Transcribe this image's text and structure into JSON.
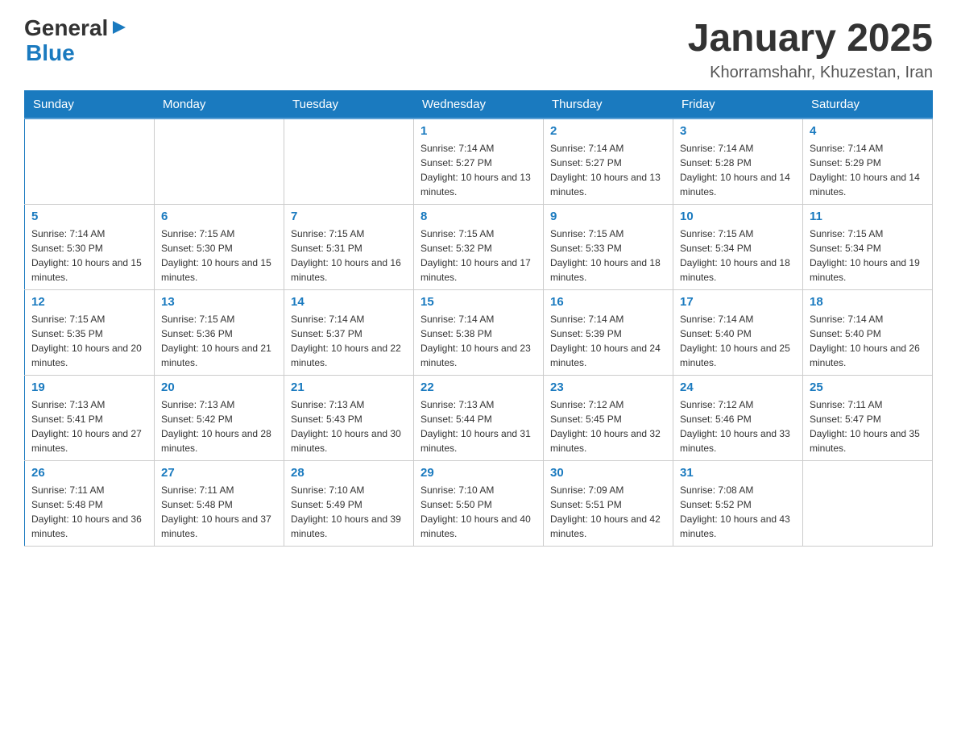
{
  "header": {
    "logo": {
      "text_general": "General",
      "arrow": "▶",
      "text_blue": "Blue"
    },
    "title": "January 2025",
    "location": "Khorramshahr, Khuzestan, Iran"
  },
  "calendar": {
    "days_of_week": [
      "Sunday",
      "Monday",
      "Tuesday",
      "Wednesday",
      "Thursday",
      "Friday",
      "Saturday"
    ],
    "weeks": [
      [
        {
          "day": "",
          "info": ""
        },
        {
          "day": "",
          "info": ""
        },
        {
          "day": "",
          "info": ""
        },
        {
          "day": "1",
          "info": "Sunrise: 7:14 AM\nSunset: 5:27 PM\nDaylight: 10 hours and 13 minutes."
        },
        {
          "day": "2",
          "info": "Sunrise: 7:14 AM\nSunset: 5:27 PM\nDaylight: 10 hours and 13 minutes."
        },
        {
          "day": "3",
          "info": "Sunrise: 7:14 AM\nSunset: 5:28 PM\nDaylight: 10 hours and 14 minutes."
        },
        {
          "day": "4",
          "info": "Sunrise: 7:14 AM\nSunset: 5:29 PM\nDaylight: 10 hours and 14 minutes."
        }
      ],
      [
        {
          "day": "5",
          "info": "Sunrise: 7:14 AM\nSunset: 5:30 PM\nDaylight: 10 hours and 15 minutes."
        },
        {
          "day": "6",
          "info": "Sunrise: 7:15 AM\nSunset: 5:30 PM\nDaylight: 10 hours and 15 minutes."
        },
        {
          "day": "7",
          "info": "Sunrise: 7:15 AM\nSunset: 5:31 PM\nDaylight: 10 hours and 16 minutes."
        },
        {
          "day": "8",
          "info": "Sunrise: 7:15 AM\nSunset: 5:32 PM\nDaylight: 10 hours and 17 minutes."
        },
        {
          "day": "9",
          "info": "Sunrise: 7:15 AM\nSunset: 5:33 PM\nDaylight: 10 hours and 18 minutes."
        },
        {
          "day": "10",
          "info": "Sunrise: 7:15 AM\nSunset: 5:34 PM\nDaylight: 10 hours and 18 minutes."
        },
        {
          "day": "11",
          "info": "Sunrise: 7:15 AM\nSunset: 5:34 PM\nDaylight: 10 hours and 19 minutes."
        }
      ],
      [
        {
          "day": "12",
          "info": "Sunrise: 7:15 AM\nSunset: 5:35 PM\nDaylight: 10 hours and 20 minutes."
        },
        {
          "day": "13",
          "info": "Sunrise: 7:15 AM\nSunset: 5:36 PM\nDaylight: 10 hours and 21 minutes."
        },
        {
          "day": "14",
          "info": "Sunrise: 7:14 AM\nSunset: 5:37 PM\nDaylight: 10 hours and 22 minutes."
        },
        {
          "day": "15",
          "info": "Sunrise: 7:14 AM\nSunset: 5:38 PM\nDaylight: 10 hours and 23 minutes."
        },
        {
          "day": "16",
          "info": "Sunrise: 7:14 AM\nSunset: 5:39 PM\nDaylight: 10 hours and 24 minutes."
        },
        {
          "day": "17",
          "info": "Sunrise: 7:14 AM\nSunset: 5:40 PM\nDaylight: 10 hours and 25 minutes."
        },
        {
          "day": "18",
          "info": "Sunrise: 7:14 AM\nSunset: 5:40 PM\nDaylight: 10 hours and 26 minutes."
        }
      ],
      [
        {
          "day": "19",
          "info": "Sunrise: 7:13 AM\nSunset: 5:41 PM\nDaylight: 10 hours and 27 minutes."
        },
        {
          "day": "20",
          "info": "Sunrise: 7:13 AM\nSunset: 5:42 PM\nDaylight: 10 hours and 28 minutes."
        },
        {
          "day": "21",
          "info": "Sunrise: 7:13 AM\nSunset: 5:43 PM\nDaylight: 10 hours and 30 minutes."
        },
        {
          "day": "22",
          "info": "Sunrise: 7:13 AM\nSunset: 5:44 PM\nDaylight: 10 hours and 31 minutes."
        },
        {
          "day": "23",
          "info": "Sunrise: 7:12 AM\nSunset: 5:45 PM\nDaylight: 10 hours and 32 minutes."
        },
        {
          "day": "24",
          "info": "Sunrise: 7:12 AM\nSunset: 5:46 PM\nDaylight: 10 hours and 33 minutes."
        },
        {
          "day": "25",
          "info": "Sunrise: 7:11 AM\nSunset: 5:47 PM\nDaylight: 10 hours and 35 minutes."
        }
      ],
      [
        {
          "day": "26",
          "info": "Sunrise: 7:11 AM\nSunset: 5:48 PM\nDaylight: 10 hours and 36 minutes."
        },
        {
          "day": "27",
          "info": "Sunrise: 7:11 AM\nSunset: 5:48 PM\nDaylight: 10 hours and 37 minutes."
        },
        {
          "day": "28",
          "info": "Sunrise: 7:10 AM\nSunset: 5:49 PM\nDaylight: 10 hours and 39 minutes."
        },
        {
          "day": "29",
          "info": "Sunrise: 7:10 AM\nSunset: 5:50 PM\nDaylight: 10 hours and 40 minutes."
        },
        {
          "day": "30",
          "info": "Sunrise: 7:09 AM\nSunset: 5:51 PM\nDaylight: 10 hours and 42 minutes."
        },
        {
          "day": "31",
          "info": "Sunrise: 7:08 AM\nSunset: 5:52 PM\nDaylight: 10 hours and 43 minutes."
        },
        {
          "day": "",
          "info": ""
        }
      ]
    ]
  }
}
